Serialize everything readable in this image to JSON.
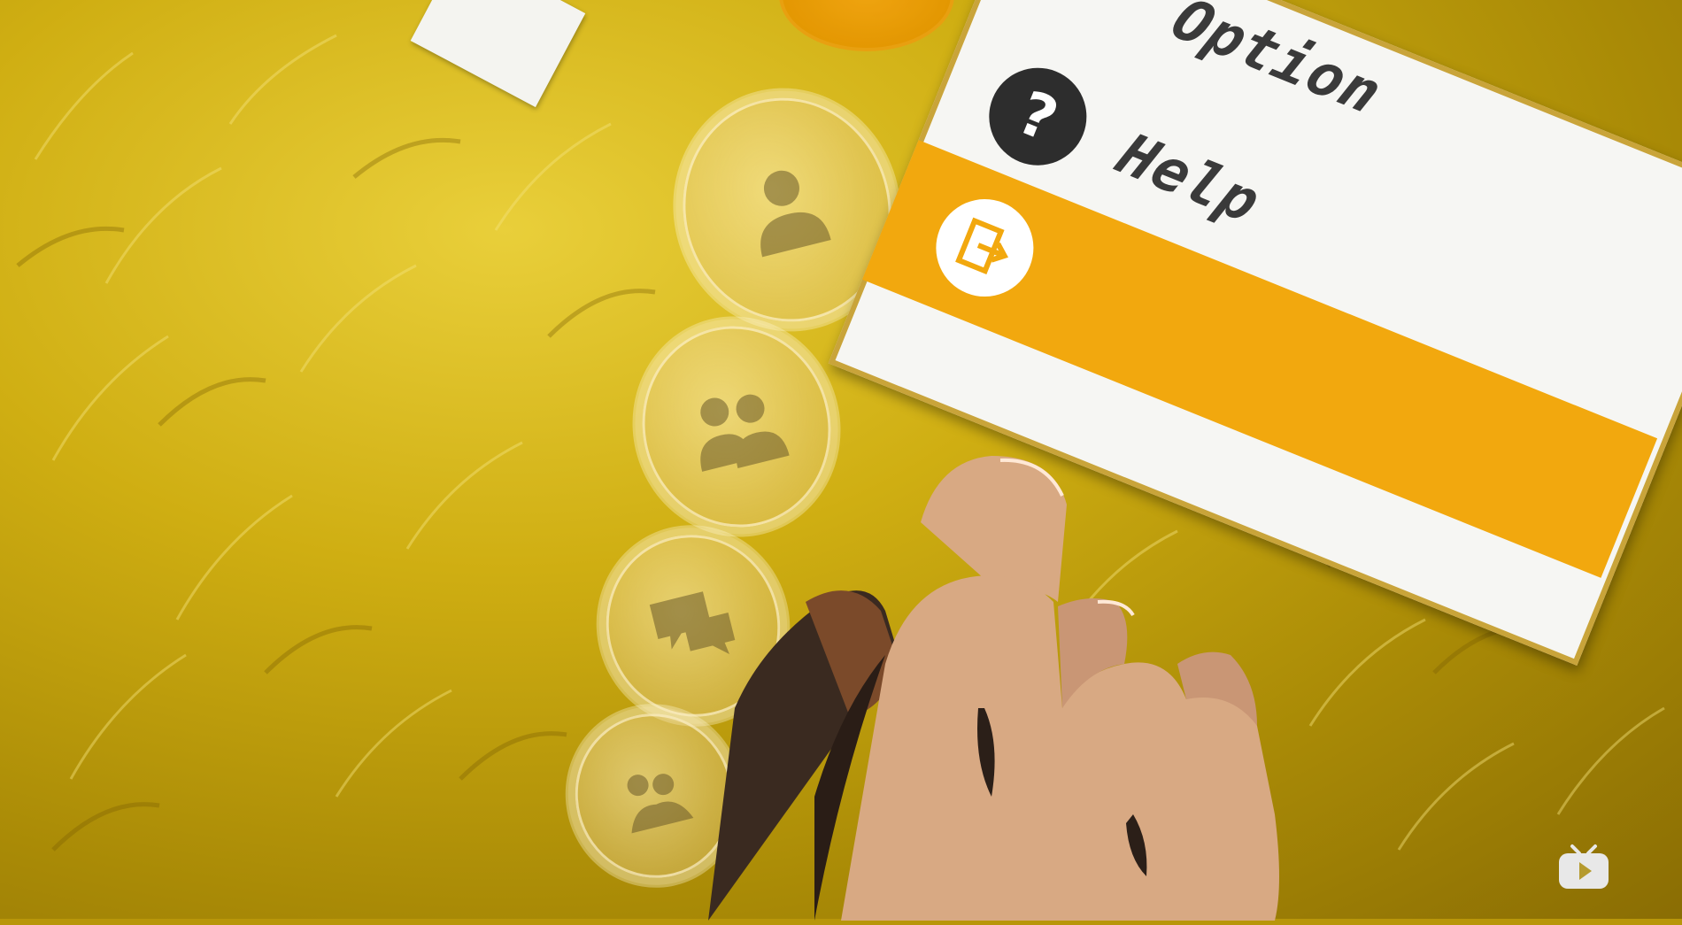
{
  "scene": {
    "background_color": "#c9a812",
    "accent_orange": "#f2a80e",
    "panel_border": "#c9a43a"
  },
  "side_menu": {
    "items": [
      {
        "name": "profile",
        "icon": "person-icon"
      },
      {
        "name": "party",
        "icon": "group-icon"
      },
      {
        "name": "messages",
        "icon": "message-icon"
      },
      {
        "name": "guild",
        "icon": "guild-icon"
      }
    ]
  },
  "main_menu": {
    "items": [
      {
        "label": "Option",
        "icon": "option-icon"
      },
      {
        "label": "Help",
        "icon": "question-mark-icon",
        "glyph": "?"
      },
      {
        "label": "",
        "icon": "logout-icon",
        "highlighted": true
      }
    ]
  },
  "watermark": {
    "icon": "tv-icon"
  }
}
